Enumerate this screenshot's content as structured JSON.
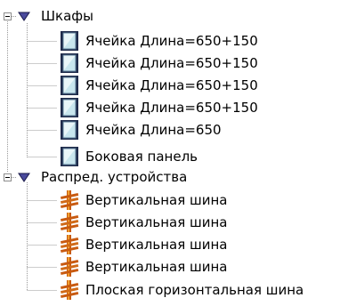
{
  "tree": {
    "groups": [
      {
        "label": "Шкафы",
        "icon": "cabinet-icon",
        "items": [
          {
            "label": "Ячейка Длина=650+150"
          },
          {
            "label": "Ячейка Длина=650+150"
          },
          {
            "label": "Ячейка Длина=650+150"
          },
          {
            "label": "Ячейка Длина=650+150"
          },
          {
            "label": "Ячейка Длина=650"
          },
          {
            "label": "Боковая панель"
          }
        ]
      },
      {
        "label": "Распред. устройства",
        "icon": "busbar-icon",
        "items": [
          {
            "label": "Вертикальная шина"
          },
          {
            "label": "Вертикальная шина"
          },
          {
            "label": "Вертикальная шина"
          },
          {
            "label": "Вертикальная шина"
          },
          {
            "label": "Плоская горизонтальная шина"
          }
        ]
      }
    ]
  },
  "colors": {
    "guide": "#9a9a9a",
    "arrow_fill": "#4a4a9c",
    "cabinet_dark": "#1e2a4a",
    "cabinet_light": "#c8e6ee",
    "busbar_copper": "#c85a10",
    "busbar_gold": "#f0a030"
  }
}
